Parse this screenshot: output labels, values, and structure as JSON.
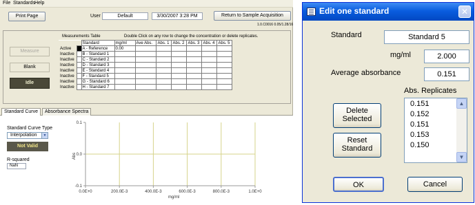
{
  "app": {
    "menu": [
      "File",
      "Standards",
      "Help"
    ],
    "print_label": "Print Page",
    "user_label": "User",
    "user_value": "Default",
    "datetime": "3/30/2007 3:28 PM",
    "return_label": "Return to Sample Acquisition",
    "version": "1.0.C0016 0.05/1.28/16",
    "side_buttons": {
      "measure": "Measure",
      "blank": "Blank",
      "idle": "Idle"
    },
    "table_title": "Measurements Table",
    "table_hint": "Double Click on any row to change the concentration or delete replicates.",
    "table_headers": [
      "Standard",
      "mg/ml",
      "Ave Abs.",
      "Abs. 1",
      "Abs. 2",
      "Abs. 3",
      "Abs. 4",
      "Abs. 5"
    ],
    "rows": [
      {
        "status": "Active",
        "selected": true,
        "standard": "A - Reference",
        "mgml": "0.00"
      },
      {
        "status": "Inactive",
        "selected": false,
        "standard": "B - Standard 1",
        "mgml": ""
      },
      {
        "status": "Inactive",
        "selected": false,
        "standard": "C - Standard 2",
        "mgml": ""
      },
      {
        "status": "Inactive",
        "selected": false,
        "standard": "D - Standard 3",
        "mgml": ""
      },
      {
        "status": "Inactive",
        "selected": false,
        "standard": "E - Standard 4",
        "mgml": ""
      },
      {
        "status": "Inactive",
        "selected": false,
        "standard": "F - Standard 5",
        "mgml": ""
      },
      {
        "status": "Inactive",
        "selected": false,
        "standard": "G - Standard 6",
        "mgml": ""
      },
      {
        "status": "Inactive",
        "selected": false,
        "standard": "H - Standard 7",
        "mgml": ""
      }
    ],
    "tabs": [
      "Standard Curve",
      "Absorbance Spectra"
    ],
    "curve_type_label": "Standard Curve Type",
    "curve_type_value": "Interpolation",
    "not_valid": "Not Valid",
    "rsq_label": "R-squared",
    "rsq_value": "NaN"
  },
  "chart_data": {
    "type": "line",
    "title": "",
    "xlabel": "mg/ml",
    "ylabel": "Abs",
    "xlim": [
      0,
      1.0
    ],
    "ylim": [
      -0.1,
      0.1
    ],
    "x_ticks": [
      "0.0E+0",
      "200.0E-3",
      "400.0E-3",
      "600.0E-3",
      "800.0E-3",
      "1.0E+0"
    ],
    "y_ticks": [
      "0.1",
      "0.0",
      "-0.1"
    ],
    "series": [],
    "grid": true,
    "colors": {
      "vertical_grid": "#d6d38a",
      "axis": "#9a9a9a"
    }
  },
  "dialog": {
    "title": "Edit one standard",
    "close_glyph": "✕",
    "standard_label": "Standard",
    "standard_value": "Standard 5",
    "mgml_label": "mg/ml",
    "mgml_value": "2.000",
    "avg_label": "Average absorbance",
    "avg_value": "0.151",
    "replicates_label": "Abs. Replicates",
    "replicates": [
      "0.151",
      "0.152",
      "0.151",
      "0.153",
      "0.150"
    ],
    "delete_label_1": "Delete",
    "delete_label_2": "Selected",
    "reset_label_1": "Reset",
    "reset_label_2": "Standard",
    "ok_label": "OK",
    "cancel_label": "Cancel"
  }
}
